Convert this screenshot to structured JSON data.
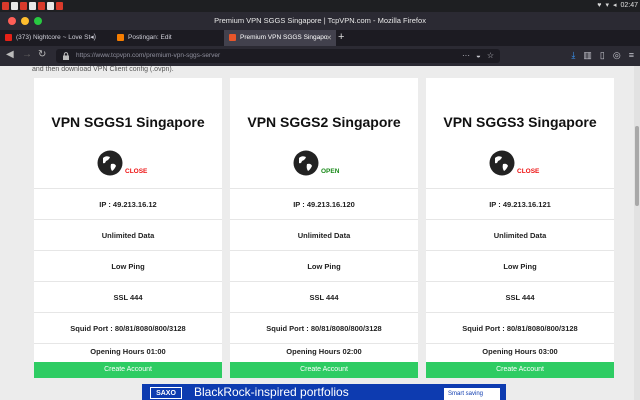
{
  "os": {
    "clock": "02:47"
  },
  "window": {
    "title": "Premium VPN SGGS Singapore | TcpVPN.com - Mozilla Firefox"
  },
  "tabs": [
    {
      "label": "(373) Nightcore ~ Love St",
      "icon_color": "#e62117",
      "active": false
    },
    {
      "label": "Postingan: Edit",
      "icon_color": "#f57d00",
      "active": false
    },
    {
      "label": "Premium VPN SGGS Singapo",
      "icon_color": "#e8562a",
      "active": true
    }
  ],
  "urlbar": {
    "url": "https://www.tcpvpn.com/premium-vpn-sggs-server"
  },
  "page": {
    "intro": "and then download VPN Client config (.ovpn).",
    "servers": [
      {
        "name": "VPN SGGS1 Singapore",
        "status": "CLOSE",
        "status_type": "close",
        "ip": "IP : 49.213.16.12",
        "data": "Unlimited Data",
        "ping": "Low Ping",
        "ssl": "SSL 444",
        "squid": "Squid Port : 80/81/8080/800/3128",
        "hours": "Opening Hours 01:00",
        "button": "Create Account"
      },
      {
        "name": "VPN SGGS2 Singapore",
        "status": "OPEN",
        "status_type": "open",
        "ip": "IP : 49.213.16.120",
        "data": "Unlimited Data",
        "ping": "Low Ping",
        "ssl": "SSL 444",
        "squid": "Squid Port : 80/81/8080/800/3128",
        "hours": "Opening Hours 02:00",
        "button": "Create Account"
      },
      {
        "name": "VPN SGGS3 Singapore",
        "status": "CLOSE",
        "status_type": "close",
        "ip": "IP : 49.213.16.121",
        "data": "Unlimited Data",
        "ping": "Low Ping",
        "ssl": "SSL 444",
        "squid": "Squid Port : 80/81/8080/800/3128",
        "hours": "Opening Hours 03:00",
        "button": "Create Account"
      }
    ]
  },
  "ad": {
    "logo": "SAXO",
    "text": "BlackRock-inspired portfolios",
    "cta": "Smart saving"
  },
  "colors": {
    "accent_green": "#2ecc63",
    "close_red": "#e11111",
    "open_green": "#1a8a1a"
  }
}
